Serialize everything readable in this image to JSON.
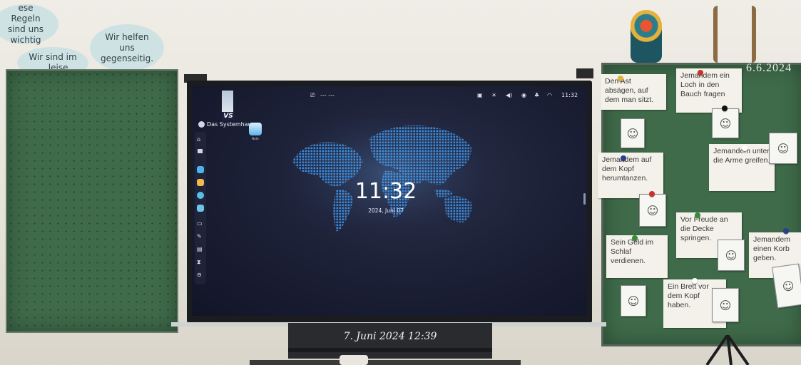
{
  "wall": {
    "bubble1_text": "ese Regeln sind uns wichtig",
    "bubble2_text": "Wir sind im ... leise",
    "bubble3_text": "Wir helfen uns gegenseitig."
  },
  "right_board": {
    "date": "6.6.2024",
    "cards": [
      {
        "text": "Den Ast absägen, auf dem man sitzt.",
        "pin_color": "#e0b43a"
      },
      {
        "text": "Jemandem ein Loch in den Bauch fragen",
        "pin_color": "#c8322b"
      },
      {
        "text": "Jemandem auf dem Kopf herumtanzen.",
        "pin_color": "#2b3f8a"
      },
      {
        "text": "Jemandem unter die Arme greifen.",
        "pin_color": "#ffffff"
      },
      {
        "text": "Vor Freude an die Decke springen.",
        "pin_color": "#3a8a3a"
      },
      {
        "text": "Sein Geld im Schlaf verdienen.",
        "pin_color": "#3a8a3a"
      },
      {
        "text": "Jemandem einen Korb geben.",
        "pin_color": "#2b3f8a"
      },
      {
        "text": "Ein Brett vor dem Kopf haben.",
        "pin_color": "#ffffff"
      }
    ]
  },
  "screen": {
    "brand_badge": "VS",
    "brand_name": "Das Systemhaus",
    "desktop_app_label": "Note",
    "top_center_label": "--- ---",
    "status_time": "11:32",
    "clock": "11:32",
    "date": "2024, Juni 07",
    "colors": {
      "map_dots": "#3d8ee0",
      "background": "#1b1f35"
    }
  },
  "footer": {
    "caption": "7. Juni 2024 12:39"
  }
}
